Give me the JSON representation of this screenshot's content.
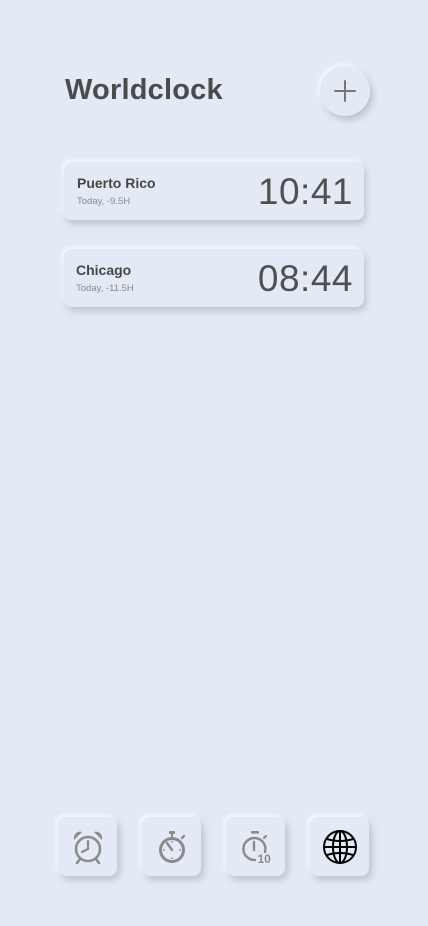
{
  "header": {
    "title": "Worldclock",
    "add_icon": "plus-icon"
  },
  "clocks": [
    {
      "city": "Puerto Rico",
      "offset": "Today, -9.5H",
      "time": "10:41"
    },
    {
      "city": "Chicago",
      "offset": "Today, -11.5H",
      "time": "08:44"
    }
  ],
  "nav": {
    "items": [
      {
        "icon": "alarm-clock-icon",
        "active": false
      },
      {
        "icon": "stopwatch-icon",
        "active": false
      },
      {
        "icon": "timer-icon",
        "active": false
      },
      {
        "icon": "globe-icon",
        "active": true
      }
    ],
    "timer_badge": "10"
  },
  "colors": {
    "background": "#e3eaf5",
    "text": "#4b4b4b",
    "icon_inactive": "#8a8a8a",
    "icon_active": "#000000"
  }
}
